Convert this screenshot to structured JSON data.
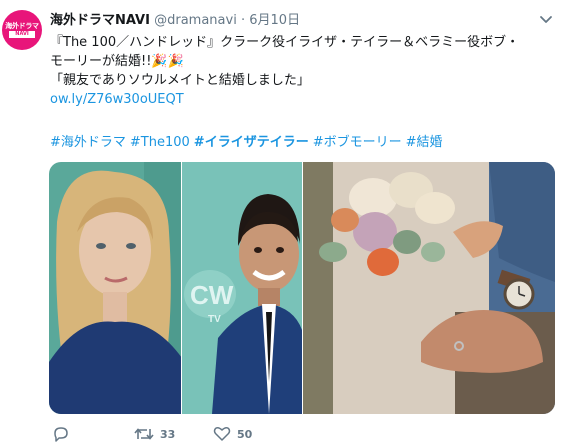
{
  "tweet": {
    "avatar_text_top": "海外ドラマ",
    "avatar_text_bottom": "NAVI",
    "display_name": "海外ドラマNAVI",
    "handle": "@dramanavi",
    "separator": "·",
    "date": "6月10日",
    "text_line1": "『The 100／ハンドレッド』クラーク役イライザ・テイラー＆ベラミー役ボブ・",
    "text_line2": "モーリーが結婚!!🎉🎉",
    "text_line3": "「親友でありソウルメイトと結婚しました」",
    "link": "ow.ly/Z76w30oUEQT",
    "hashtags": [
      {
        "text": "#海外ドラマ",
        "bold": false
      },
      {
        "text": "#The100",
        "bold": false
      },
      {
        "text": "#イライザテイラー",
        "bold": true
      },
      {
        "text": "#ボブモーリー",
        "bold": false
      },
      {
        "text": "#結婚",
        "bold": false
      }
    ],
    "media_backdrop_text": "CW",
    "media_backdrop_text2": "TV",
    "actions": {
      "reply_count": "",
      "retweet_count": "33",
      "like_count": "50"
    }
  },
  "colors": {
    "accent": "#1b95e0",
    "secondary_text": "#657786",
    "avatar_bg": "#e8157a"
  }
}
